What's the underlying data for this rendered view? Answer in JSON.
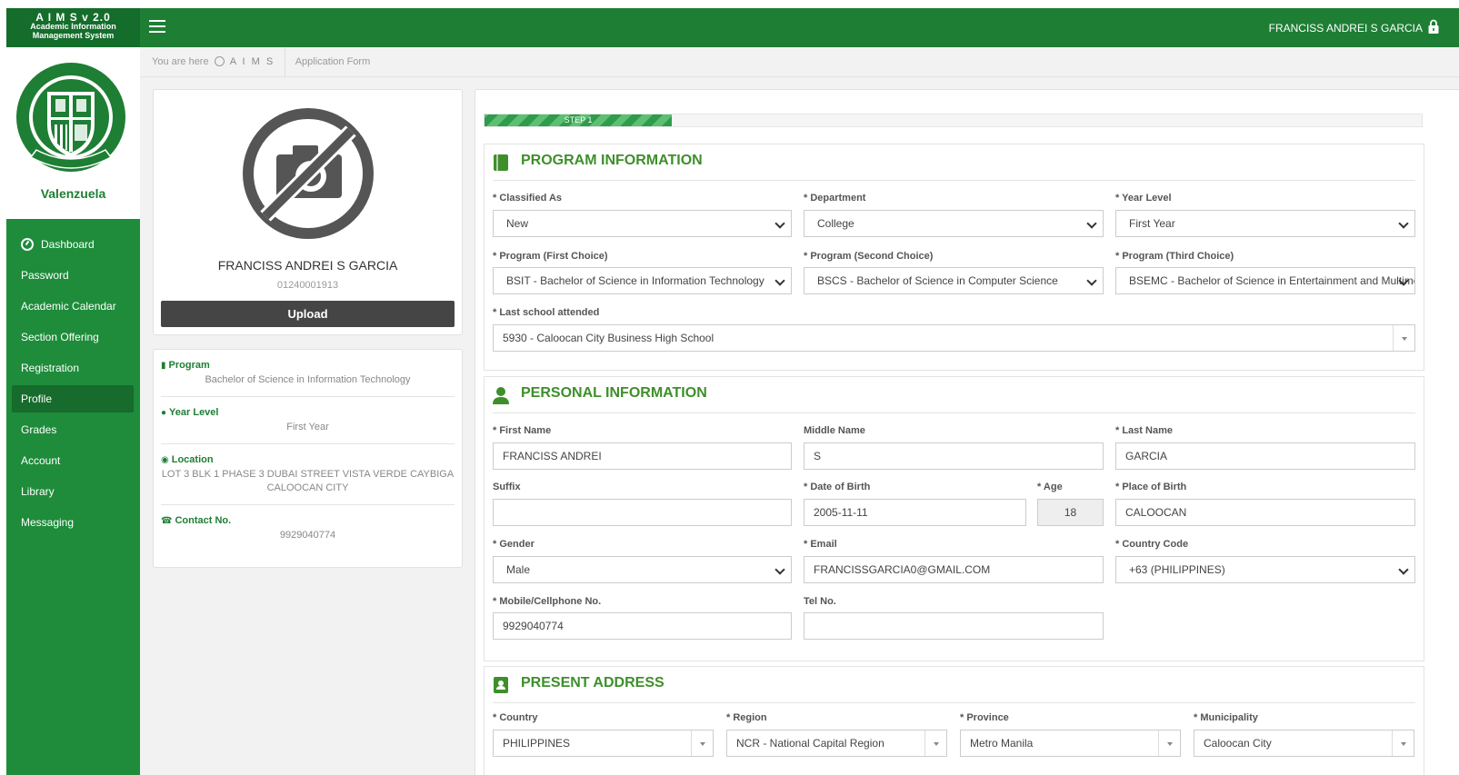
{
  "brand": {
    "title": "A I M S v 2.0",
    "line1": "Academic Information",
    "line2": "Management System"
  },
  "topbar": {
    "user_name": "FRANCISS ANDREI S GARCIA"
  },
  "sidebar": {
    "campus": "Valenzuela",
    "items": [
      {
        "label": "Dashboard"
      },
      {
        "label": "Password"
      },
      {
        "label": "Academic Calendar"
      },
      {
        "label": "Section Offering"
      },
      {
        "label": "Registration"
      },
      {
        "label": "Profile"
      },
      {
        "label": "Grades"
      },
      {
        "label": "Account"
      },
      {
        "label": "Library"
      },
      {
        "label": "Messaging"
      }
    ],
    "active_item": "Profile"
  },
  "breadcrumb": {
    "prefix": "You are here",
    "root": "A I M S",
    "current": "Application Form"
  },
  "profile": {
    "name": "FRANCISS ANDREI S GARCIA",
    "id": "01240001913",
    "upload_label": "Upload"
  },
  "info": {
    "program_label": "Program",
    "program": "Bachelor of Science in Information Technology",
    "year_label": "Year Level",
    "year": "First Year",
    "location_label": "Location",
    "location": "LOT 3 BLK 1 PHASE 3 DUBAI STREET VISTA VERDE CAYBIGA CALOOCAN CITY",
    "contact_label": "Contact No.",
    "contact": "9929040774"
  },
  "step": {
    "label": "STEP 1",
    "progress": 0.2
  },
  "program_info": {
    "title": "PROGRAM INFORMATION",
    "classified_label": "* Classified As",
    "classified": "New",
    "department_label": "* Department",
    "department": "College",
    "year_label": "* Year Level",
    "year": "First Year",
    "prog1_label": "* Program (First Choice)",
    "prog1": "BSIT - Bachelor of Science in Information Technology",
    "prog2_label": "* Program (Second Choice)",
    "prog2": "BSCS - Bachelor of Science in Computer Science",
    "prog3_label": "* Program (Third Choice)",
    "prog3": "BSEMC - Bachelor of Science in Entertainment and Multimedia Computing",
    "school_label": "* Last school attended",
    "school": "5930 - Caloocan City Business High School"
  },
  "personal_info": {
    "title": "PERSONAL INFORMATION",
    "first_label": "* First Name",
    "first": "FRANCISS ANDREI",
    "middle_label": "Middle Name",
    "middle": "S",
    "last_label": "* Last Name",
    "last": "GARCIA",
    "suffix_label": "Suffix",
    "suffix": "",
    "dob_label": "* Date of Birth",
    "dob": "2005-11-11",
    "age_label": "* Age",
    "age": "18",
    "pob_label": "* Place of Birth",
    "pob": "CALOOCAN",
    "gender_label": "* Gender",
    "gender": "Male",
    "email_label": "* Email",
    "email": "FRANCISSGARCIA0@GMAIL.COM",
    "country_code_label": "* Country Code",
    "country_code": "+63 (PHILIPPINES)",
    "mobile_label": "* Mobile/Cellphone No.",
    "mobile": "9929040774",
    "tel_label": "Tel No.",
    "tel": ""
  },
  "address": {
    "title": "PRESENT ADDRESS",
    "country_label": "* Country",
    "country": "PHILIPPINES",
    "region_label": "* Region",
    "region": "NCR - National Capital Region",
    "province_label": "* Province",
    "province": "Metro Manila",
    "municipality_label": "* Municipality",
    "municipality": "Caloocan City"
  },
  "colors": {
    "topbar": "#1e7e34",
    "sidebar": "#1e8c3a",
    "section_title": "#3e8f2b",
    "upload_button": "#454545"
  }
}
